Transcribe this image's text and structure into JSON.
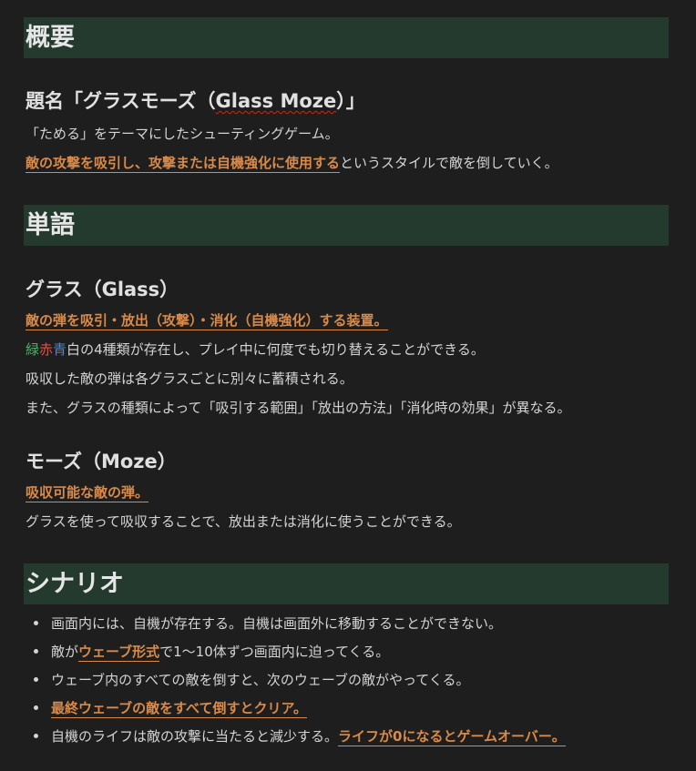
{
  "sections": {
    "overview": {
      "heading": "概要",
      "title_prefix": "題名「グラスモーズ（",
      "title_spell": "Glass Moze",
      "title_suffix": "）」",
      "line1": "「ためる」をテーマにしたシューティングゲーム。",
      "line2_highlight": "敵の攻撃を吸引し、攻撃または自機強化に使用する",
      "line2_rest": "というスタイルで敵を倒していく。"
    },
    "words": {
      "heading": "単語",
      "glass": {
        "title": "グラス（Glass）",
        "highlight": "敵の弾を吸引・放出（攻撃）・消化（自機強化）する装置。",
        "color_green": "緑",
        "color_red": "赤",
        "color_blue": "青",
        "color_white": "白",
        "line1_rest": "の4種類が存在し、プレイ中に何度でも切り替えることができる。",
        "line2": "吸収した敵の弾は各グラスごとに別々に蓄積される。",
        "line3": "また、グラスの種類によって「吸引する範囲」「放出の方法」「消化時の効果」が異なる。"
      },
      "moze": {
        "title": "モーズ（Moze）",
        "highlight": "吸収可能な敵の弾。",
        "line1": "グラスを使って吸収することで、放出または消化に使うことができる。"
      }
    },
    "scenario": {
      "heading": "シナリオ",
      "item1": "画面内には、自機が存在する。自機は画面外に移動することができない。",
      "item2_pre": "敵が",
      "item2_hl": "ウェーブ形式",
      "item2_post": "で1〜10体ずつ画面内に迫ってくる。",
      "item3": "ウェーブ内のすべての敵を倒すと、次のウェーブの敵がやってくる。",
      "item4_hl": "最終ウェーブの敵をすべて倒すとクリア。",
      "item5_pre": "自機のライフは敵の攻撃に当たると減少する。",
      "item5_hl": "ライフが0になるとゲームオーバー。"
    }
  },
  "colors": {
    "background": "#1e1e1e",
    "heading_band": "#243a2e",
    "highlight": "#d98a4a"
  }
}
